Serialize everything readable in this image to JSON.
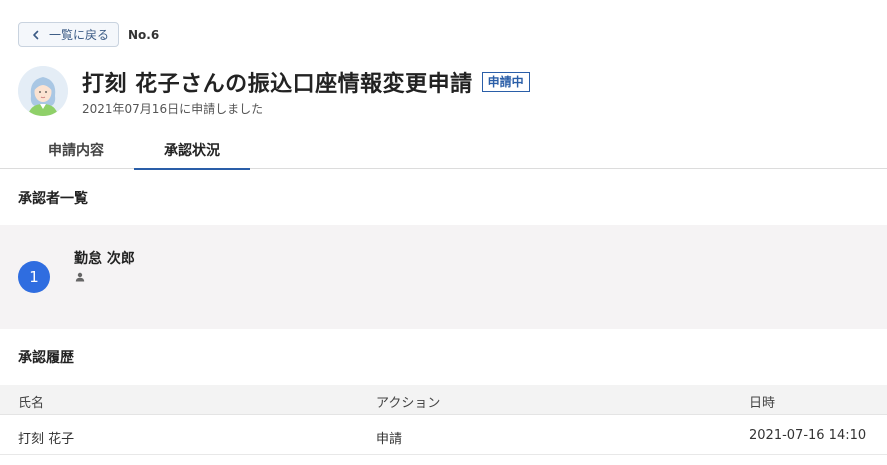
{
  "header": {
    "back_label": "一覧に戻る",
    "doc_number": "No.6"
  },
  "request": {
    "title": "打刻 花子さんの振込口座情報変更申請",
    "status": "申請中",
    "submitted_text": "2021年07月16日に申請しました"
  },
  "tabs": [
    {
      "label": "申請内容",
      "active": false
    },
    {
      "label": "承認状況",
      "active": true
    }
  ],
  "approvers": {
    "section_title": "承認者一覧",
    "items": [
      {
        "step": "1",
        "name": "勤怠 次郎"
      }
    ]
  },
  "history": {
    "section_title": "承認履歴",
    "columns": [
      "氏名",
      "アクション",
      "日時"
    ],
    "rows": [
      {
        "name": "打刻 花子",
        "action": "申請",
        "datetime": "2021-07-16 14:10"
      }
    ]
  },
  "colors": {
    "accent": "#2a5ea8",
    "step_circle": "#2f6de0",
    "panel_bg": "#f5f3f4"
  },
  "icons": {
    "back": "chevron-left-icon",
    "avatar": "user-avatar-illustration",
    "approver": "person-icon"
  }
}
